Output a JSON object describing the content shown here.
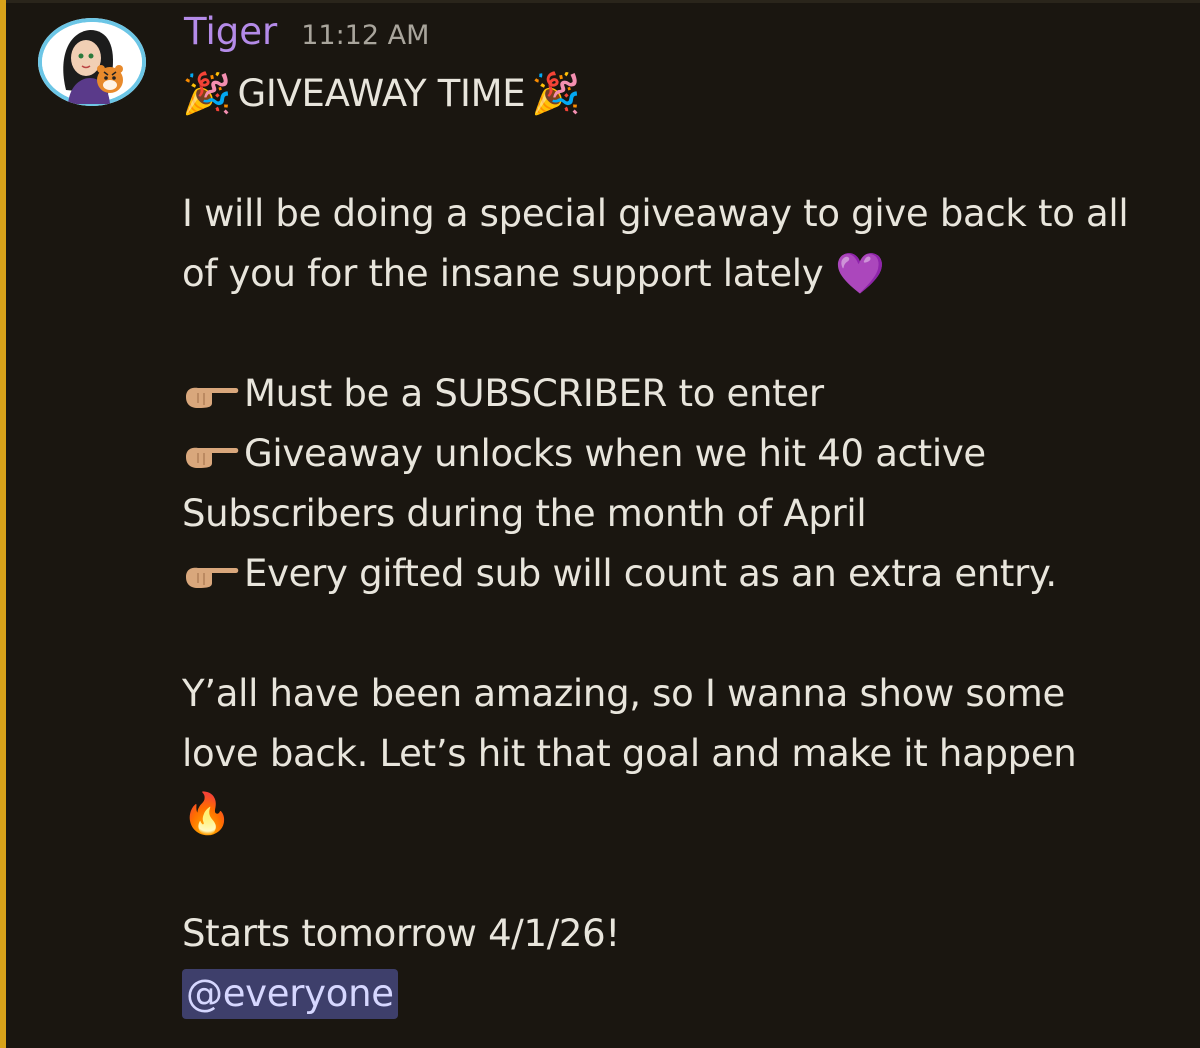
{
  "message": {
    "author": "Tiger",
    "timestamp": "11:12 AM",
    "title": "GIVEAWAY TIME",
    "paragraph1_line1": "I will be doing a special giveaway to give back to all",
    "paragraph1_line2": "of you for the insane support lately",
    "bullet1": "Must be a SUBSCRIBER to enter",
    "bullet2_line1": " Giveaway unlocks when we hit 40 active",
    "bullet2_line2": "Subscribers during the month of April",
    "bullet3": " Every gifted sub will count as an extra entry.",
    "paragraph2_line1": "Y’all have been amazing, so I wanna show some",
    "paragraph2_line2": "love back. Let’s hit that goal and make it happen",
    "closing": "Starts tomorrow 4/1/26!",
    "mention": "@everyone"
  },
  "emojis": {
    "party": "🎉",
    "purple_heart": "💜",
    "fire": "🔥"
  },
  "icons": {
    "avatar": "avatar-image",
    "pointer": "pointing-right-hand-icon"
  },
  "colors": {
    "background": "#1a1610",
    "accent_bar": "#d8a21a",
    "username": "#b48be8",
    "text": "#e8e5dc",
    "mention_bg": "#3e3f6b"
  }
}
